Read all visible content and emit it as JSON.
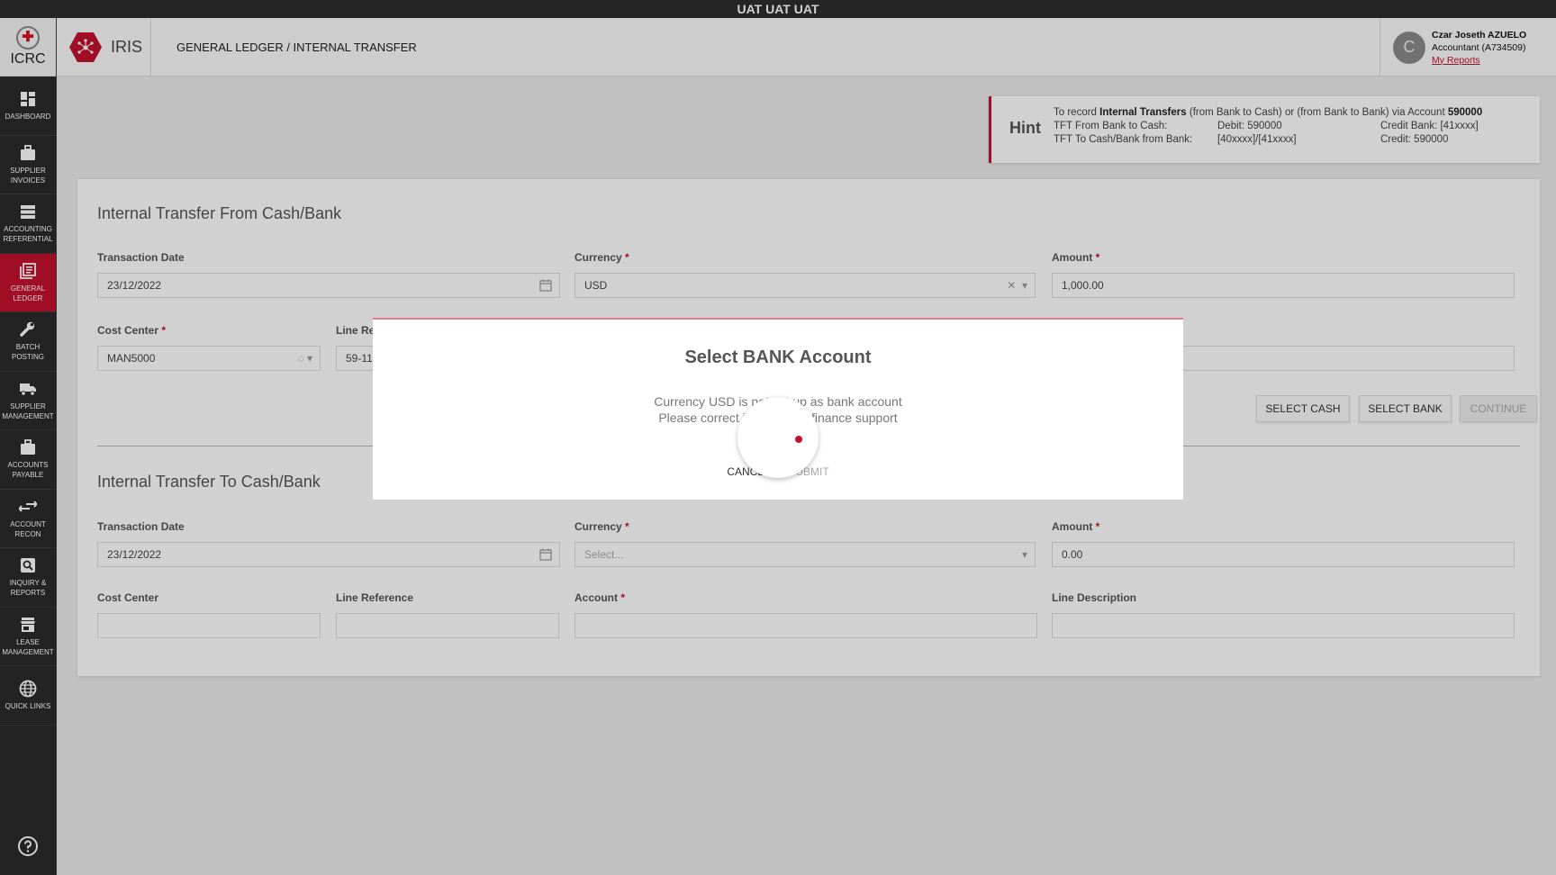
{
  "env": {
    "label": "UAT UAT UAT"
  },
  "sidebar": {
    "org": "ICRC",
    "items": [
      {
        "label": "DASHBOARD",
        "icon": "dashboard-icon"
      },
      {
        "label": "SUPPLIER INVOICES",
        "icon": "briefcase-icon"
      },
      {
        "label": "ACCOUNTING REFERENTIAL",
        "icon": "list-icon"
      },
      {
        "label": "GENERAL LEDGER",
        "icon": "ledger-icon",
        "active": true
      },
      {
        "label": "BATCH POSTING",
        "icon": "wrench-icon"
      },
      {
        "label": "SUPPLIER MANAGEMENT",
        "icon": "truck-icon"
      },
      {
        "label": "ACCOUNTS PAYABLE",
        "icon": "briefcase-icon"
      },
      {
        "label": "ACCOUNT RECON",
        "icon": "arrows-icon"
      },
      {
        "label": "INQUIRY & REPORTS",
        "icon": "search-icon"
      },
      {
        "label": "LEASE MANAGEMENT",
        "icon": "store-icon"
      },
      {
        "label": "QUICK LINKS",
        "icon": "globe-icon"
      }
    ]
  },
  "header": {
    "app_name": "IRIS",
    "breadcrumb": "GENERAL LEDGER / INTERNAL TRANSFER",
    "user": {
      "initial": "C",
      "name": "Czar Joseth AZUELO",
      "role": "Accountant (A734509)",
      "link": "My Reports"
    }
  },
  "hint": {
    "title": "Hint",
    "intro_prefix": "To record",
    "intro_bold": "Internal Transfers",
    "intro_mid": "(from Bank to Cash) or (from Bank to Bank) via Account",
    "intro_account": "590000",
    "rows": [
      {
        "label": "TFT From Bank to Cash:",
        "debit": "Debit: 590000",
        "credit": "Credit Bank: [41xxxx]"
      },
      {
        "label": "TFT To Cash/Bank from Bank:",
        "debit": "[40xxxx]/[41xxxx]",
        "credit": "Credit: 590000"
      }
    ]
  },
  "from_section": {
    "title": "Internal Transfer From Cash/Bank",
    "transaction_date_label": "Transaction Date",
    "transaction_date": "23/12/2022",
    "currency_label": "Currency",
    "currency": "USD",
    "amount_label": "Amount",
    "amount": "1,000.00",
    "cost_center_label": "Cost Center",
    "cost_center": "MAN5000",
    "line_ref_label": "Line Re",
    "line_ref": "59-11",
    "buttons": {
      "select_cash": "SELECT CASH",
      "select_bank": "SELECT BANK",
      "continue": "CONTINUE"
    }
  },
  "to_section": {
    "title": "Internal Transfer To Cash/Bank",
    "transaction_date_label": "Transaction Date",
    "transaction_date": "23/12/2022",
    "currency_label": "Currency",
    "currency_placeholder": "Select...",
    "amount_label": "Amount",
    "amount": "0.00",
    "cost_center_label": "Cost Center",
    "line_ref_label": "Line Reference",
    "account_label": "Account",
    "line_desc_label": "Line Description"
  },
  "required_mark": "*",
  "modal": {
    "title": "Select BANK Account",
    "message_line1": "Currency USD is not set up as bank account",
    "message_line2": "Please correct it or contact finance support",
    "cancel": "CANCEL",
    "submit": "SUBMIT"
  },
  "colors": {
    "brand": "#c4122f",
    "sidebar": "#2b2b2b",
    "env_bar": "#2e2e2e"
  }
}
